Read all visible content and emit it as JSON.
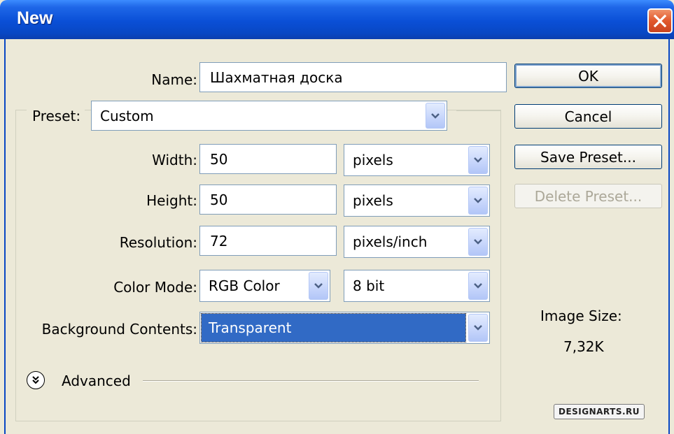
{
  "window": {
    "title": "New"
  },
  "name": {
    "label": "Name:",
    "value": "Шахматная доска"
  },
  "preset": {
    "label": "Preset:",
    "value": "Custom"
  },
  "width": {
    "label": "Width:",
    "value": "50",
    "unit": "pixels"
  },
  "height": {
    "label": "Height:",
    "value": "50",
    "unit": "pixels"
  },
  "resolution": {
    "label": "Resolution:",
    "value": "72",
    "unit": "pixels/inch"
  },
  "color_mode": {
    "label": "Color Mode:",
    "mode": "RGB Color",
    "depth": "8 bit"
  },
  "background": {
    "label": "Background Contents:",
    "value": "Transparent"
  },
  "advanced": {
    "label": "Advanced"
  },
  "buttons": {
    "ok": "OK",
    "cancel": "Cancel",
    "save_preset": "Save Preset...",
    "delete_preset": "Delete Preset..."
  },
  "image_size": {
    "label": "Image Size:",
    "value": "7,32K"
  },
  "watermark": "DESIGNARTS.RU",
  "colors": {
    "titlebar": "#0a4fd6",
    "selection": "#316ac5",
    "dialog_bg": "#ece9d8"
  }
}
